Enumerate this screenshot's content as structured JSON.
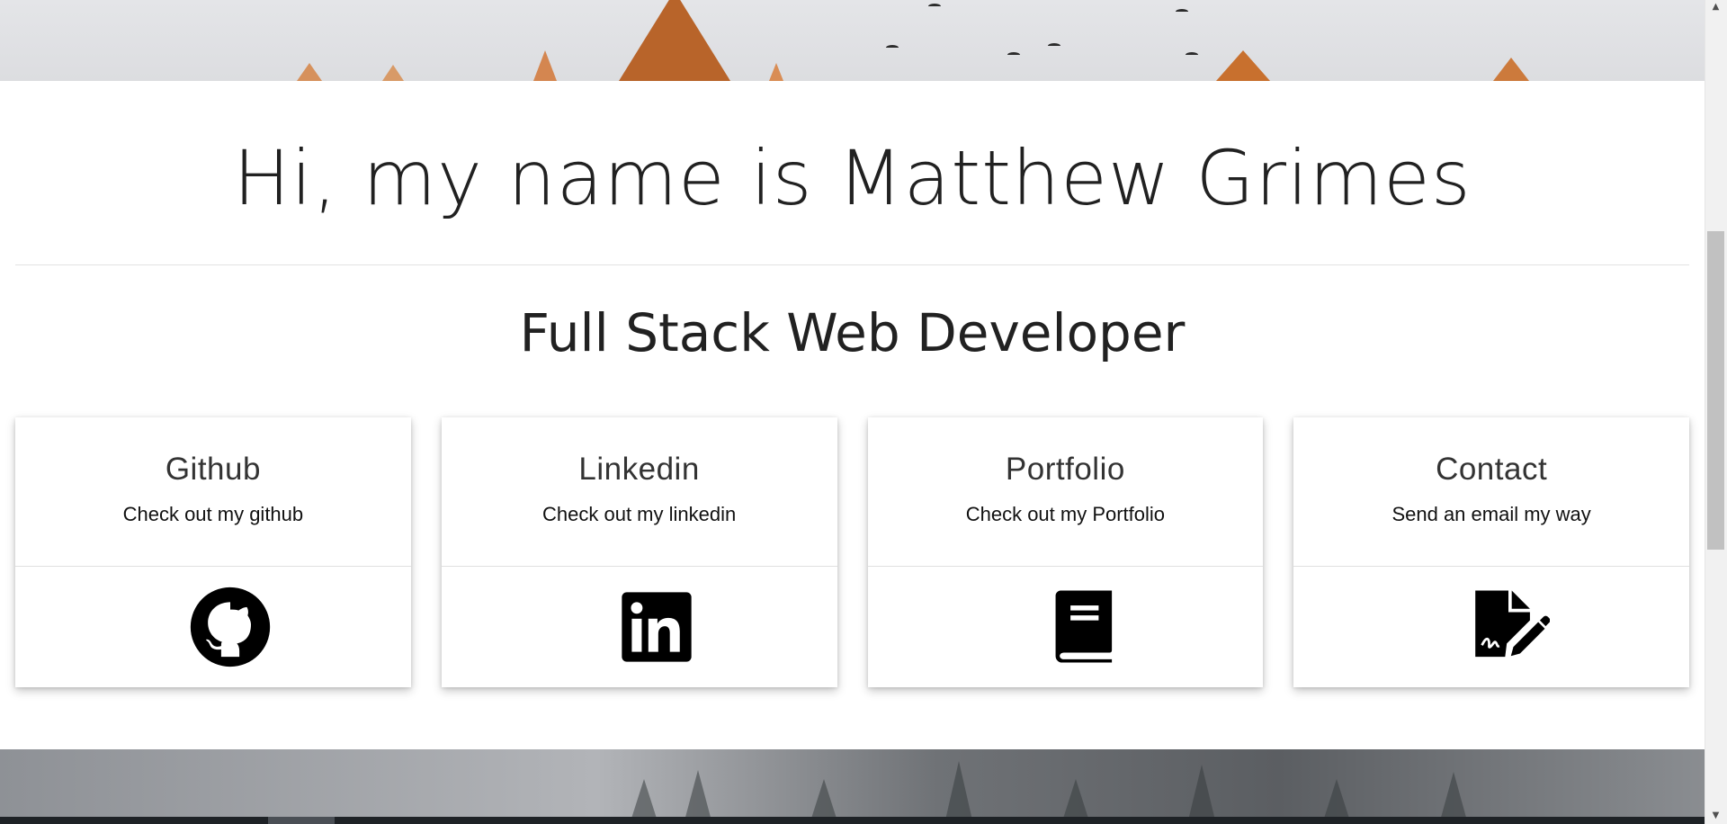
{
  "header": {
    "name_title": "Hi, my name is Matthew Grimes",
    "subtitle": "Full Stack Web Developer"
  },
  "cards": [
    {
      "title": "Github",
      "text": "Check out my github",
      "icon": "github-icon"
    },
    {
      "title": "Linkedin",
      "text": "Check out my linkedin",
      "icon": "linkedin-icon"
    },
    {
      "title": "Portfolio",
      "text": "Check out my Portfolio",
      "icon": "book-icon"
    },
    {
      "title": "Contact",
      "text": "Send an email my way",
      "icon": "file-signature-icon"
    }
  ],
  "colors": {
    "text": "#212121",
    "card_background": "#ffffff",
    "divider": "#e2e2e2",
    "tree_orange": "#c76f2a"
  }
}
